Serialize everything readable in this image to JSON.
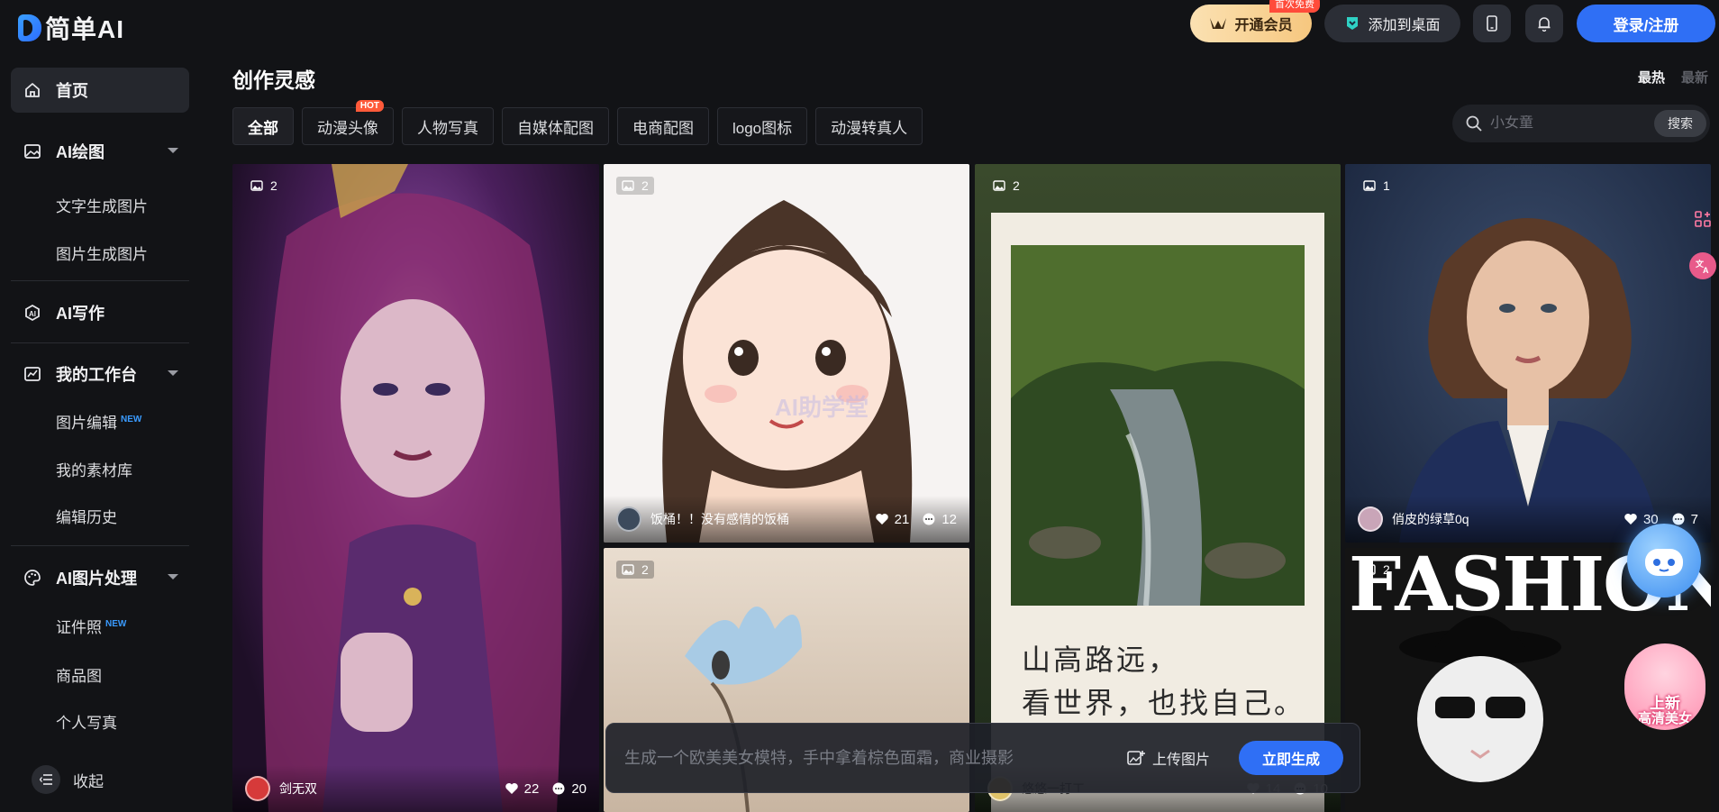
{
  "app": {
    "logo_text": "简单AI",
    "accent": "#2f6ff5"
  },
  "header": {
    "vip_label": "开通会员",
    "vip_tag": "首次免费",
    "desktop_label": "添加到桌面",
    "login_label": "登录/注册"
  },
  "sidebar": {
    "home": "首页",
    "ai_draw": "AI绘图",
    "text2img": "文字生成图片",
    "img2img": "图片生成图片",
    "ai_write": "AI写作",
    "workspace": "我的工作台",
    "img_edit": "图片编辑",
    "img_edit_tag": "NEW",
    "assets": "我的素材库",
    "history": "编辑历史",
    "ai_process": "AI图片处理",
    "id_photo": "证件照",
    "id_photo_tag": "NEW",
    "product": "商品图",
    "portrait": "个人写真",
    "collapse": "收起"
  },
  "main": {
    "title": "创作灵感",
    "sort_hot": "最热",
    "sort_new": "最新",
    "tabs": [
      "全部",
      "动漫头像",
      "人物写真",
      "自媒体配图",
      "电商配图",
      "logo图标",
      "动漫转真人"
    ],
    "hot_tag": "HOT",
    "search_placeholder": "小女童",
    "search_btn": "搜索"
  },
  "cards": [
    {
      "count": "2",
      "author": "剑无双",
      "likes": "22",
      "comments": "20"
    },
    {
      "count": "2",
      "author": "饭桶！！没有感情的饭桶",
      "likes": "21",
      "comments": "12",
      "watermark": "AI助学堂"
    },
    {
      "count": "2",
      "author": "悠悠一打工",
      "likes": "14",
      "comments": "10",
      "poem_line1": "山高路远，",
      "poem_line2": "看世界，也找自己。"
    },
    {
      "count": "1",
      "author": "俏皮的绿草0q",
      "likes": "30",
      "comments": "7"
    },
    {
      "count": "2",
      "fashion_text": "FASHION"
    },
    {
      "count": "2"
    }
  ],
  "promo": {
    "line1": "上新",
    "line2": "高清美女"
  },
  "prompt": {
    "placeholder": "生成一个欧美美女模特，手中拿着棕色面霜，商业摄影",
    "upload_label": "上传图片",
    "generate_label": "立即生成"
  }
}
